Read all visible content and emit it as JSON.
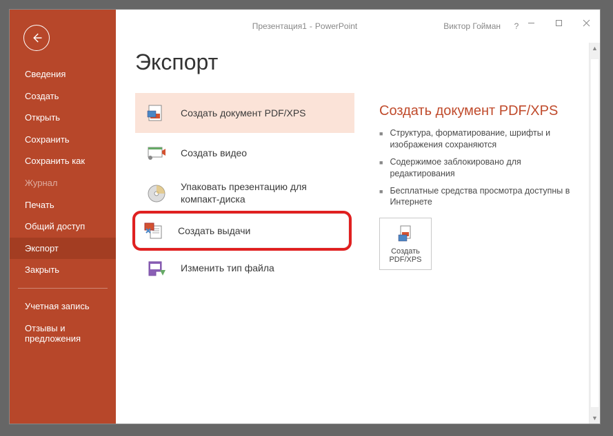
{
  "titlebar": {
    "doc_name": "Презентация1",
    "app_name": "PowerPoint",
    "separator": " -  ",
    "user": "Виктор Гойман",
    "help": "?"
  },
  "sidebar": {
    "items": [
      {
        "label": "Сведения"
      },
      {
        "label": "Создать"
      },
      {
        "label": "Открыть"
      },
      {
        "label": "Сохранить"
      },
      {
        "label": "Сохранить как"
      },
      {
        "label": "Журнал",
        "disabled": true
      },
      {
        "label": "Печать"
      },
      {
        "label": "Общий доступ"
      },
      {
        "label": "Экспорт",
        "active": true
      },
      {
        "label": "Закрыть"
      }
    ],
    "footer": [
      {
        "label": "Учетная запись"
      },
      {
        "label": "Отзывы и предложения"
      }
    ]
  },
  "page": {
    "title": "Экспорт"
  },
  "export_options": [
    {
      "label": "Создать документ PDF/XPS",
      "icon": "pdf"
    },
    {
      "label": "Создать видео",
      "icon": "video"
    },
    {
      "label": "Упаковать презентацию для компакт-диска",
      "icon": "disc"
    },
    {
      "label": "Создать выдачи",
      "icon": "handout",
      "highlight": true
    },
    {
      "label": "Изменить тип файла",
      "icon": "savefile"
    }
  ],
  "detail": {
    "title": "Создать документ PDF/XPS",
    "bullets": [
      "Структура, форматирование, шрифты и изображения сохраняются",
      "Содержимое заблокировано для редактирования",
      "Бесплатные средства просмотра доступны в Интернете"
    ],
    "action_label": "Создать PDF/XPS"
  }
}
